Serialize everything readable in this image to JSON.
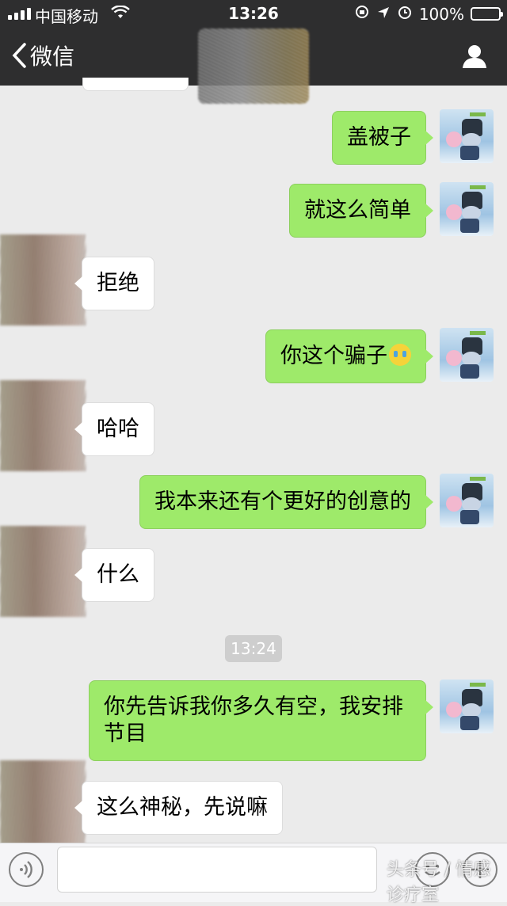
{
  "status_bar": {
    "carrier": "中国移动",
    "time": "13:26",
    "battery": "100%",
    "battery_level": 1.0
  },
  "nav": {
    "back_label": "微信",
    "icons": {
      "back": "chevron-left-icon",
      "profile": "person-icon"
    }
  },
  "messages": [
    {
      "from": "me",
      "text": "盖被子"
    },
    {
      "from": "me",
      "text": "就这么简单"
    },
    {
      "from": "other",
      "text": "拒绝"
    },
    {
      "from": "me",
      "text": "你这个骗子",
      "emoji": "crying-face-icon"
    },
    {
      "from": "other",
      "text": "哈哈"
    },
    {
      "from": "me",
      "text": "我本来还有个更好的创意的"
    },
    {
      "from": "other",
      "text": "什么"
    },
    {
      "from": "me",
      "text": "你先告诉我你多久有空，我安排节目"
    },
    {
      "from": "other",
      "text": "这么神秘，先说嘛"
    }
  ],
  "timestamp": "13:24",
  "watermark": "头条号 / 情感诊疗室",
  "colors": {
    "nav_bg": "#2e2e2f",
    "chat_bg": "#ebebeb",
    "my_bubble": "#9eea6a",
    "other_bubble": "#ffffff",
    "battery_fill": "#4cd964"
  }
}
